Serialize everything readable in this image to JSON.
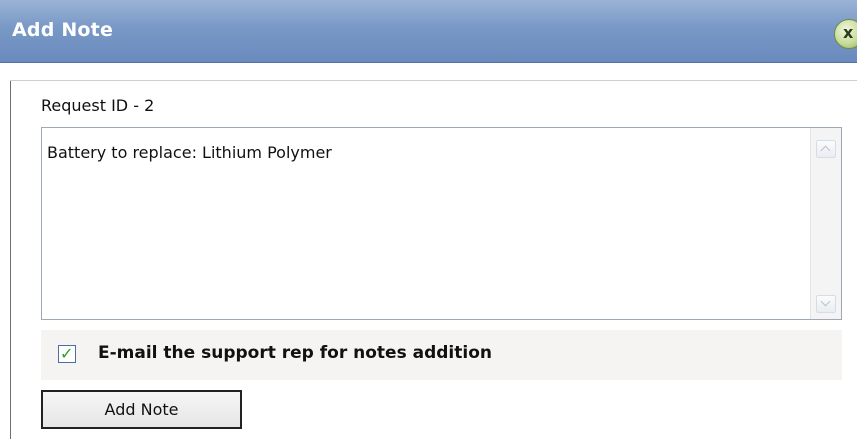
{
  "dialog": {
    "title": "Add Note",
    "close_label": "x"
  },
  "request": {
    "label": "Request ID - 2"
  },
  "note": {
    "value": "Battery to replace: Lithium Polymer"
  },
  "email_option": {
    "label": "E-mail the support rep for notes addition",
    "checked": true
  },
  "actions": {
    "submit_label": "Add Note"
  },
  "colors": {
    "titlebar": "#7898c6",
    "close_button": "#c7dc9a",
    "checkbox_check": "#2b9b2b"
  }
}
